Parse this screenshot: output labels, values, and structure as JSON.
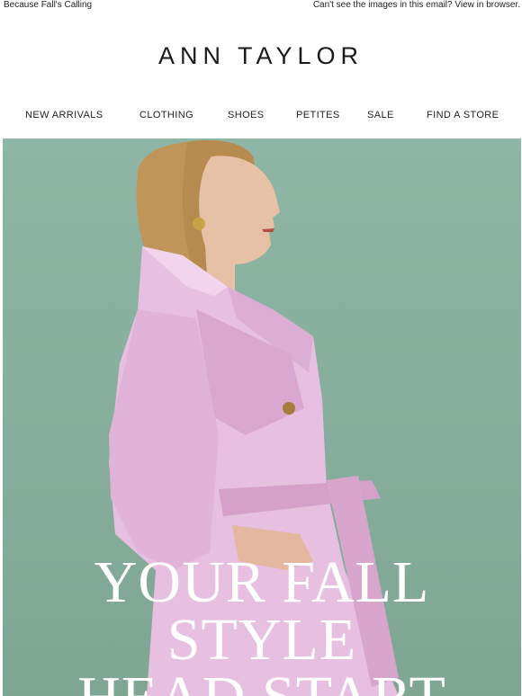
{
  "preheader": {
    "left_text": "Because Fall's Calling",
    "right_text": "Can't see the images in this email? View in browser."
  },
  "brand": {
    "logo_text": "ANN TAYLOR"
  },
  "nav": {
    "items": [
      {
        "label": "NEW ARRIVALS"
      },
      {
        "label": "CLOTHING"
      },
      {
        "label": "SHOES"
      },
      {
        "label": "PETITES"
      },
      {
        "label": "SALE"
      },
      {
        "label": "FIND A STORE"
      }
    ]
  },
  "hero": {
    "headline_line1": "YOUR FALL",
    "headline_line2": "STYLE",
    "headline_line3": "HEAD START",
    "background_color": "#8fb5a4",
    "coat_color": "#e7bfe0"
  }
}
